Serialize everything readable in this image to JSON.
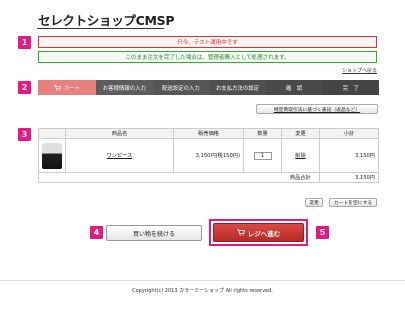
{
  "page": {
    "title": "セレクトショップCMSP",
    "footer": "Copyright(c) 2013 カラーミーショップ All rights reserved."
  },
  "badges": [
    "1",
    "2",
    "3",
    "4",
    "5"
  ],
  "notices": {
    "warning": "只今、テスト運用中です",
    "info": "このまま注文を完了した場合は、管理者購入として処理されます。"
  },
  "links": {
    "back_to_shop": "ショップへ戻る",
    "tokushoho": "特定商取引法に基づく表記（返品など）"
  },
  "steps": [
    {
      "label": "カート",
      "icon": "cart-icon"
    },
    {
      "label": "お客様情報の入力"
    },
    {
      "label": "配送設定の入力"
    },
    {
      "label": "お支払方法の設定"
    },
    {
      "label": "確　認"
    },
    {
      "label": "完　了"
    }
  ],
  "cart": {
    "headers": {
      "product": "商品名",
      "price": "販売価格",
      "qty": "数量",
      "change": "変更",
      "subtotal": "小計"
    },
    "items": [
      {
        "name": "ワンピース",
        "price": "3,150円(税150円)",
        "qty": "1",
        "delete": "削除",
        "subtotal": "3,150円"
      }
    ],
    "total_label": "商品合計",
    "total_value": "3,150円"
  },
  "buttons": {
    "change": "変更",
    "clear_cart": "カートを空にする",
    "continue": "買い物を続ける",
    "checkout": "レジへ進む"
  },
  "colors": {
    "accent": "#e5197e",
    "checkout": "#c9302c",
    "cart_step": "#e8807e"
  }
}
